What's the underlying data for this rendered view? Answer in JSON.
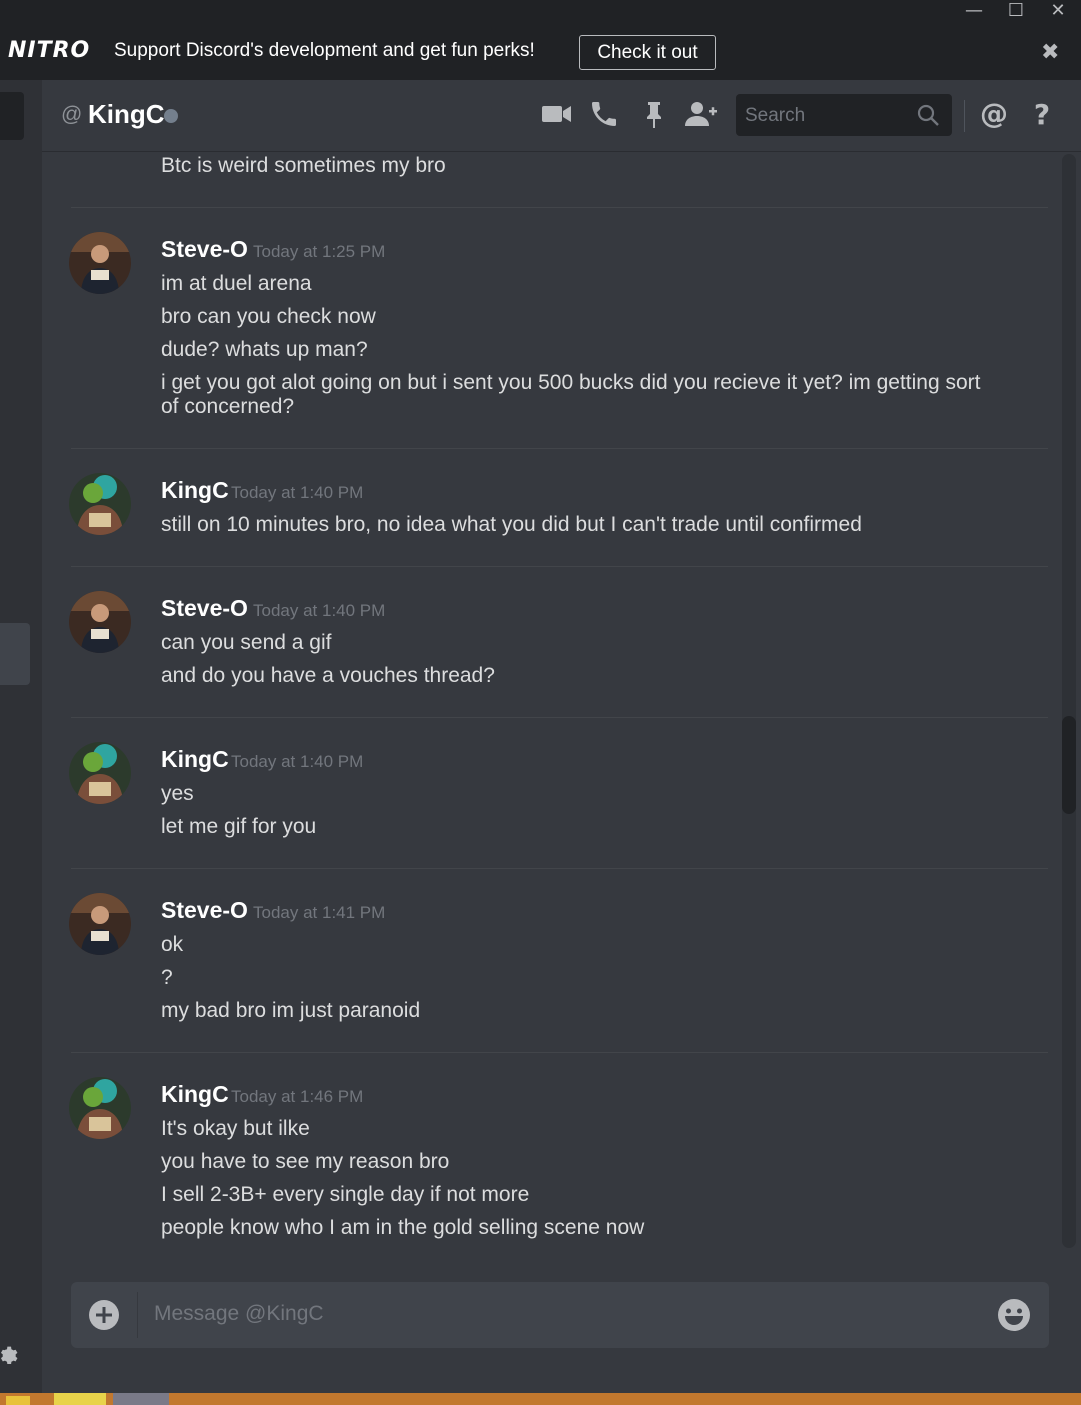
{
  "window": {
    "minimize": "—",
    "maximize": "☐",
    "close": "✕"
  },
  "banner": {
    "logo": "NITRO",
    "text": "Support Discord's development and get fun perks!",
    "button": "Check it out",
    "close": "✖"
  },
  "header": {
    "prefix": "@",
    "name": "KingC",
    "search_placeholder": "Search",
    "status": "offline",
    "icons": [
      "video-camera-icon",
      "phone-icon",
      "pin-icon",
      "add-friend-icon",
      "search-icon",
      "mention-icon",
      "help-icon"
    ]
  },
  "messages": {
    "top_line": "Btc is weird sometimes my bro",
    "groups": [
      {
        "author": "Steve-O",
        "time": "Today at 1:25 PM",
        "lines": [
          "im at duel arena",
          "bro can you check now",
          "dude? whats up man?",
          "i get you got alot going on but i sent you 500 bucks did you recieve it yet? im getting sort of concerned?"
        ]
      },
      {
        "author": "KingC",
        "time": "Today at 1:40 PM",
        "lines": [
          "still on 10 minutes bro, no idea what you did but I can't trade until confirmed"
        ]
      },
      {
        "author": "Steve-O",
        "time": "Today at 1:40 PM",
        "lines": [
          "can you send a gif",
          "and do you have a vouches thread?"
        ]
      },
      {
        "author": "KingC",
        "time": "Today at 1:40 PM",
        "lines": [
          "yes",
          "let me gif for you"
        ]
      },
      {
        "author": "Steve-O",
        "time": "Today at 1:41 PM",
        "lines": [
          "ok",
          "?",
          "my bad bro im just paranoid"
        ]
      },
      {
        "author": "KingC",
        "time": "Today at 1:46 PM",
        "lines": [
          "It's okay but ilke",
          "you have to see my reason bro",
          "I sell 2-3B+ every single day if not more",
          "people know who I am in the gold selling scene now"
        ]
      }
    ]
  },
  "composer": {
    "placeholder": "Message @KingC"
  },
  "colors": {
    "background": "#36393f",
    "sidebar": "#2f3136",
    "banner": "#202225",
    "input": "#40444b",
    "text": "#dcddde",
    "muted": "#72767d",
    "taskbar": "#c2782e"
  }
}
